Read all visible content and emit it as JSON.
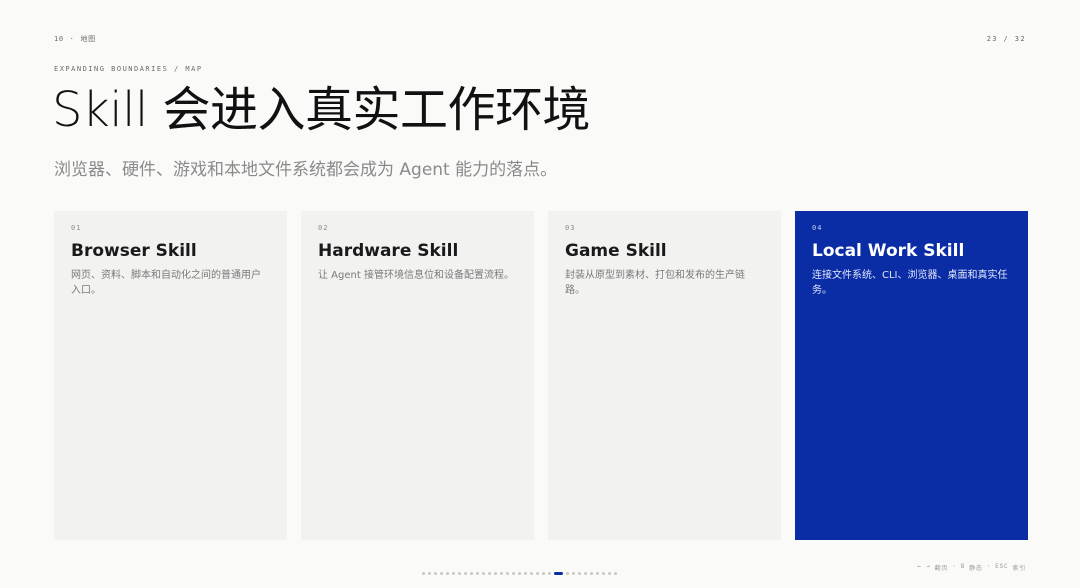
{
  "header": {
    "section_number": "10",
    "separator": "·",
    "section_name": "地图",
    "page_counter": "23 / 32"
  },
  "kicker": "EXPANDING BOUNDARIES / MAP",
  "title": "Skill 会进入真实工作环境",
  "subtitle": "浏览器、硬件、游戏和本地文件系统都会成为 Agent 能力的落点。",
  "cards": [
    {
      "number": "01",
      "title": "Browser Skill",
      "description": "网页、资料、脚本和自动化之间的普通用户入口。",
      "active": false
    },
    {
      "number": "02",
      "title": "Hardware Skill",
      "description": "让 Agent 接管环境信息位和设备配置流程。",
      "active": false
    },
    {
      "number": "03",
      "title": "Game Skill",
      "description": "封装从原型到素材、打包和发布的生产链路。",
      "active": false
    },
    {
      "number": "04",
      "title": "Local Work Skill",
      "description": "连接文件系统、CLI、浏览器、桌面和真实任务。",
      "active": true
    }
  ],
  "pagination": {
    "total": 32,
    "current": 23
  },
  "hints": {
    "arrows": "← →",
    "arrows_label": "翻页",
    "separator": "·",
    "key_b": "B",
    "key_b_label": "静态",
    "key_esc": "ESC",
    "key_esc_label": "索引"
  },
  "colors": {
    "accent": "#0a2da6",
    "background": "#fafaf9",
    "card": "#f2f2f1"
  }
}
